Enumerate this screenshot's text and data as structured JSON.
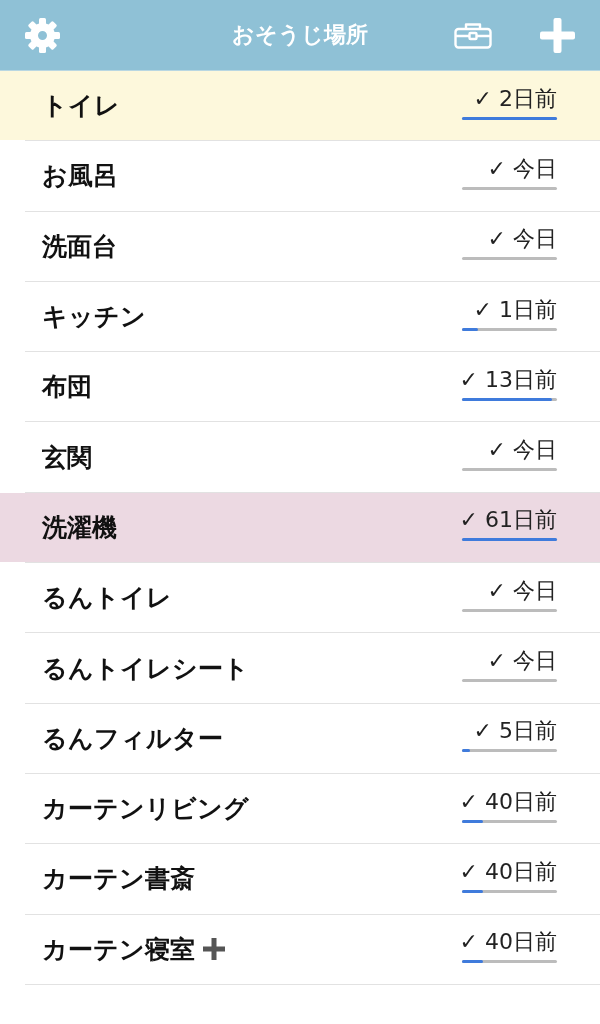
{
  "header": {
    "title": "おそうじ場所"
  },
  "places": [
    {
      "name": "トイレ",
      "color": "#fdf8dc",
      "elapsed": "✓ 2日前",
      "level": 1.0,
      "plus_mark": false
    },
    {
      "name": "お風呂",
      "color": "#ffffff",
      "elapsed": "✓ 今日",
      "level": 0,
      "plus_mark": false
    },
    {
      "name": "洗面台",
      "color": "#ffffff",
      "elapsed": "✓ 今日",
      "level": 0,
      "plus_mark": false
    },
    {
      "name": "キッチン",
      "color": "#ffffff",
      "elapsed": "✓ 1日前",
      "level": 0.17,
      "plus_mark": false
    },
    {
      "name": "布団",
      "color": "#ffffff",
      "elapsed": "✓ 13日前",
      "level": 0.95,
      "plus_mark": false
    },
    {
      "name": "玄関",
      "color": "#ffffff",
      "elapsed": "✓ 今日",
      "level": 0,
      "plus_mark": false
    },
    {
      "name": "洗濯機",
      "color": "#ecd9e2",
      "elapsed": "✓ 61日前",
      "level": 1.0,
      "plus_mark": false
    },
    {
      "name": "るんトイレ",
      "color": "#ffffff",
      "elapsed": "✓ 今日",
      "level": 0,
      "plus_mark": false
    },
    {
      "name": "るんトイレシート",
      "color": "#ffffff",
      "elapsed": "✓ 今日",
      "level": 0,
      "plus_mark": false
    },
    {
      "name": "るんフィルター",
      "color": "#ffffff",
      "elapsed": "✓ 5日前",
      "level": 0.08,
      "plus_mark": false
    },
    {
      "name": "カーテンリビング",
      "color": "#ffffff",
      "elapsed": "✓ 40日前",
      "level": 0.22,
      "plus_mark": false
    },
    {
      "name": "カーテン書斎",
      "color": "#ffffff",
      "elapsed": "✓ 40日前",
      "level": 0.22,
      "plus_mark": false
    },
    {
      "name": "カーテン寝室",
      "color": "#ffffff",
      "elapsed": "✓ 40日前",
      "level": 0.22,
      "plus_mark": true
    }
  ]
}
